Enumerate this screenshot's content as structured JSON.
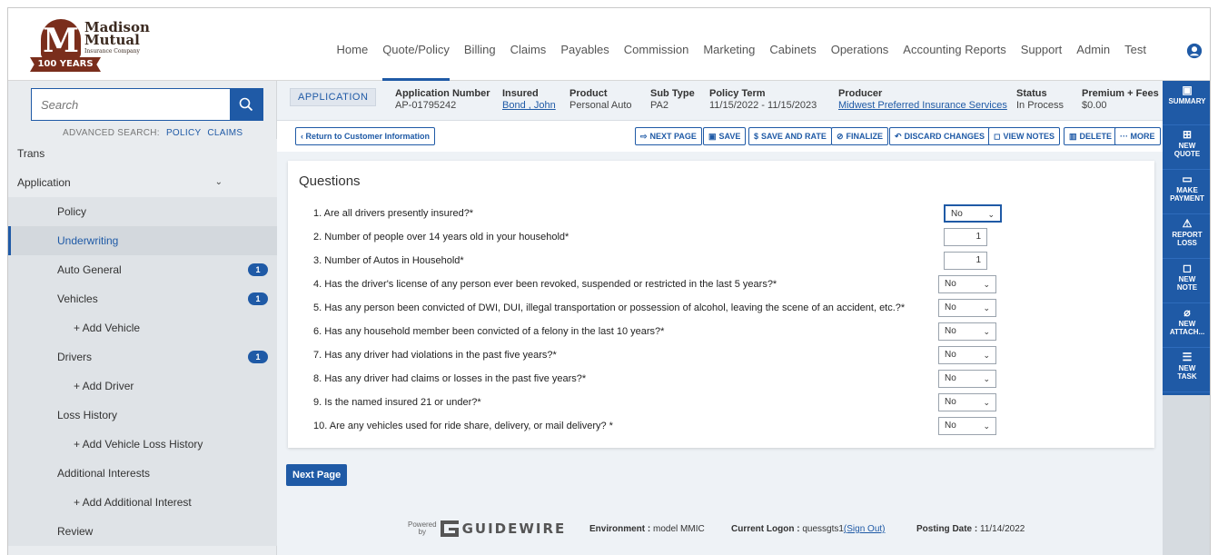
{
  "logo": {
    "line1": "Madison",
    "line2": "Mutual",
    "company": "Insurance Company",
    "ribbon": "100 YEARS",
    "letter": "M"
  },
  "nav": [
    "Home",
    "Quote/Policy",
    "Billing",
    "Claims",
    "Payables",
    "Commission",
    "Marketing",
    "Cabinets",
    "Operations",
    "Accounting Reports",
    "Support",
    "Admin",
    "Test"
  ],
  "nav_active": "Quote/Policy",
  "search": {
    "placeholder": "Search",
    "adv_label": "ADVANCED SEARCH:",
    "adv_policy": "POLICY",
    "adv_claims": "CLAIMS"
  },
  "tree": [
    {
      "label": "Trans",
      "level": 0
    },
    {
      "label": "Application",
      "level": 0,
      "chevron": "⌄"
    },
    {
      "label": "Policy",
      "level": 1
    },
    {
      "label": "Underwriting",
      "level": 1,
      "selected": true
    },
    {
      "label": "Auto General",
      "level": 1,
      "badge": "1"
    },
    {
      "label": "Vehicles",
      "level": 1,
      "badge": "1"
    },
    {
      "label": "+ Add Vehicle",
      "level": 2
    },
    {
      "label": "Drivers",
      "level": 1,
      "badge": "1"
    },
    {
      "label": "+ Add Driver",
      "level": 2
    },
    {
      "label": "Loss History",
      "level": 1
    },
    {
      "label": "+ Add Vehicle Loss History",
      "level": 2
    },
    {
      "label": "Additional Interests",
      "level": 1
    },
    {
      "label": "+ Add Additional Interest",
      "level": 2
    },
    {
      "label": "Review",
      "level": 1
    }
  ],
  "info": {
    "tag": "APPLICATION",
    "app_number_label": "Application Number",
    "app_number": "AP-01795242",
    "insured_label": "Insured",
    "insured": "Bond , John",
    "product_label": "Product",
    "product": "Personal Auto",
    "subtype_label": "Sub Type",
    "subtype": "PA2",
    "term_label": "Policy Term",
    "term": "11/15/2022 - 11/15/2023",
    "producer_label": "Producer",
    "producer": "Midwest Preferred Insurance Services",
    "status_label": "Status",
    "status": "In Process",
    "premium_label": "Premium + Fees",
    "premium": "$0.00"
  },
  "toolbar": {
    "back": "‹ Return to Customer Information",
    "next_page": "NEXT PAGE",
    "save": "SAVE",
    "save_rate": "SAVE AND RATE",
    "finalize": "FINALIZE",
    "discard": "DISCARD CHANGES",
    "view_notes": "VIEW NOTES",
    "delete": "DELETE",
    "more": "··· MORE"
  },
  "questions": {
    "title": "Questions",
    "items": [
      {
        "text": "1. Are all drivers presently insured?*",
        "type": "select",
        "value": "No"
      },
      {
        "text": "2. Number of people over 14 years old in your household*",
        "type": "number",
        "value": "1"
      },
      {
        "text": "3. Number of Autos in Household*",
        "type": "number",
        "value": "1"
      },
      {
        "text": "4. Has the driver's license of any person ever been revoked, suspended or restricted in the last 5 years?*",
        "type": "select",
        "value": "No"
      },
      {
        "text": "5. Has any person been convicted of DWI, DUI, illegal transportation or possession of alcohol, leaving the scene of an accident, etc.?*",
        "type": "select",
        "value": "No"
      },
      {
        "text": "6. Has any household member been convicted of a felony in the last 10 years?*",
        "type": "select",
        "value": "No"
      },
      {
        "text": "7. Has any driver had violations in the past five years?*",
        "type": "select",
        "value": "No"
      },
      {
        "text": "8. Has any driver had claims or losses in the past five years?*",
        "type": "select",
        "value": "No"
      },
      {
        "text": "9. Is the named insured 21 or under?*",
        "type": "select",
        "value": "No"
      },
      {
        "text": "10. Are any vehicles used for ride share, delivery, or mail delivery? *",
        "type": "select",
        "value": "No"
      }
    ]
  },
  "next_page_button": "Next Page",
  "footer": {
    "powered": "Powered",
    "by": "by",
    "brand": "GUIDEWIRE",
    "env_label": "Environment :",
    "env_value": "model MMIC",
    "logon_label": "Current Logon :",
    "logon_value": "quessgts1",
    "sign_out": "(Sign Out)",
    "posting_label": "Posting Date :",
    "posting_value": "11/14/2022"
  },
  "rail": [
    {
      "icon": "id-card-icon",
      "glyph": "▣",
      "label1": "SUMMARY",
      "label2": ""
    },
    {
      "icon": "new-document-icon",
      "glyph": "⊞",
      "label1": "NEW",
      "label2": "QUOTE"
    },
    {
      "icon": "cash-icon",
      "glyph": "▭",
      "label1": "MAKE",
      "label2": "PAYMENT"
    },
    {
      "icon": "car-crash-icon",
      "glyph": "⚠",
      "label1": "REPORT",
      "label2": "LOSS"
    },
    {
      "icon": "note-icon",
      "glyph": "◻",
      "label1": "NEW",
      "label2": "NOTE"
    },
    {
      "icon": "paperclip-icon",
      "glyph": "⌀",
      "label1": "NEW",
      "label2": "ATTACH..."
    },
    {
      "icon": "task-list-icon",
      "glyph": "☰",
      "label1": "NEW",
      "label2": "TASK"
    }
  ],
  "colors": {
    "brand_blue": "#1f5aa6",
    "logo_brown": "#7a2e1c"
  }
}
